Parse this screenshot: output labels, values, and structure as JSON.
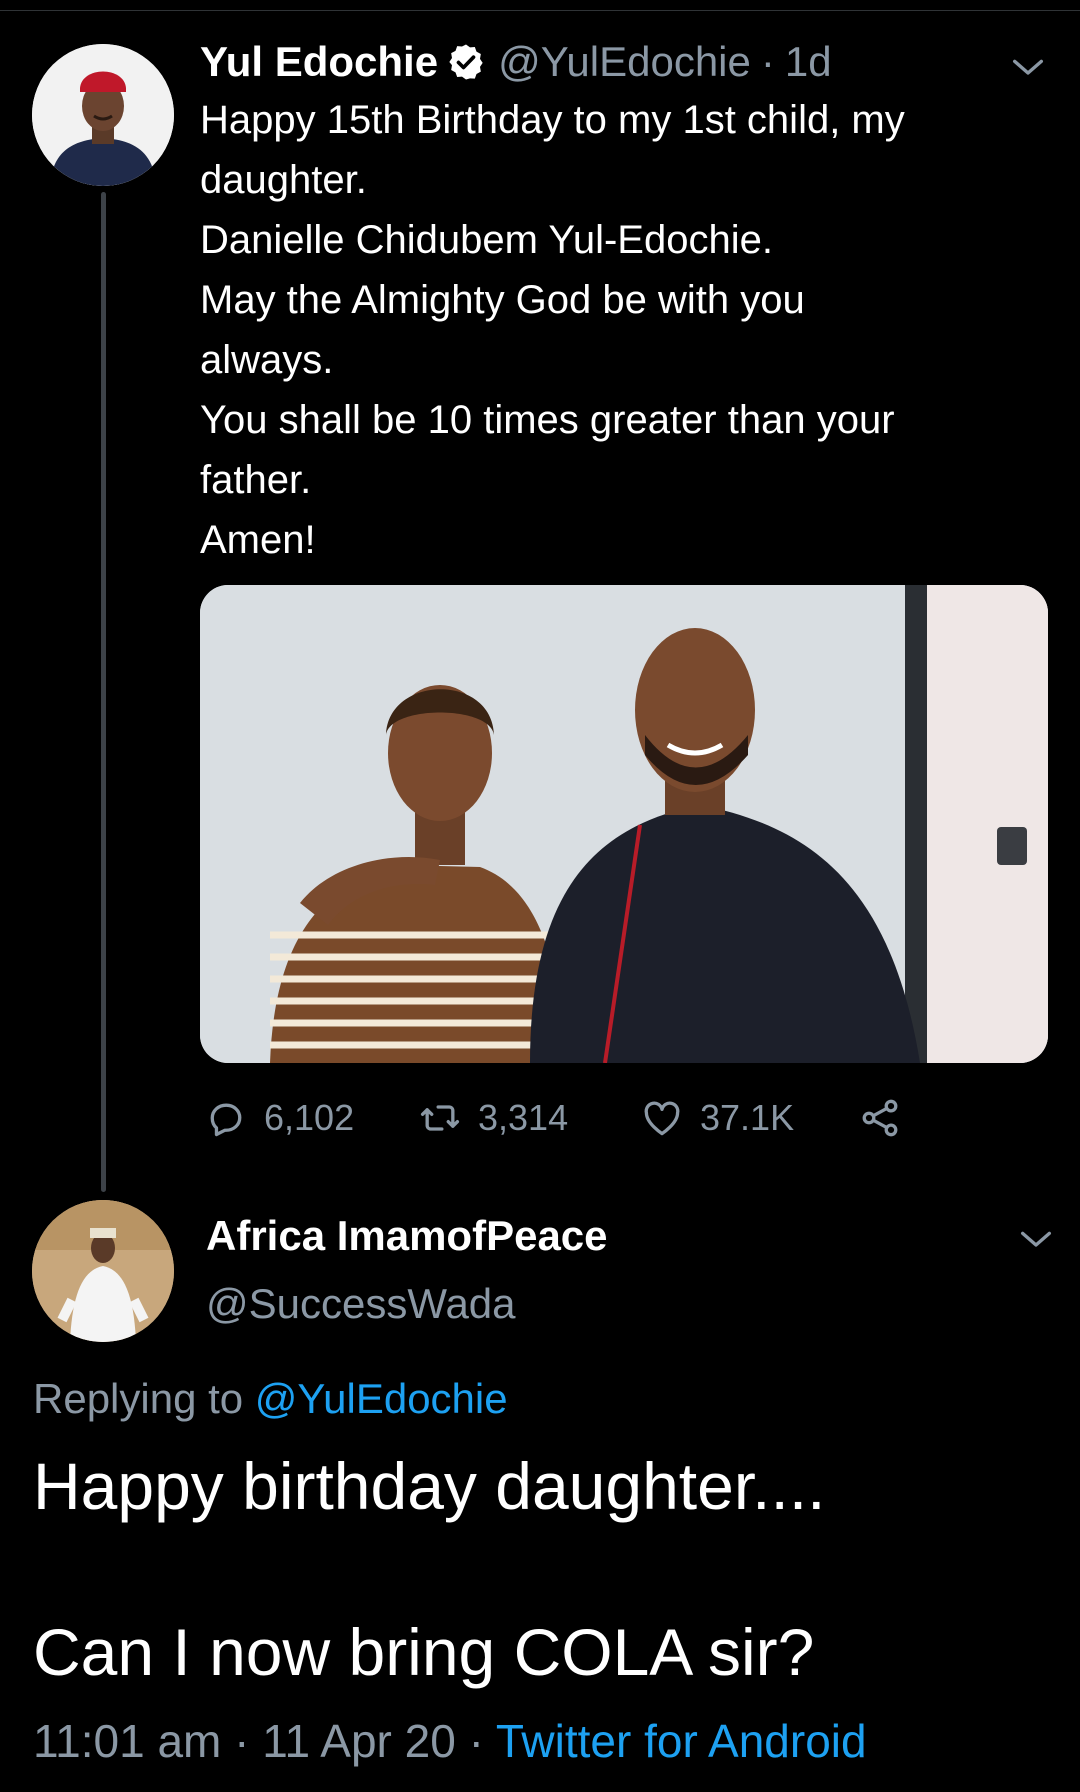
{
  "colors": {
    "background": "#000000",
    "text": "#ffffff",
    "muted": "#8b98a5",
    "link": "#1da1f2",
    "thread_line": "#3d4248"
  },
  "tweet": {
    "author_name": "Yul Edochie",
    "verified_icon": "verified-badge-icon",
    "handle": "@YulEdochie",
    "separator": "·",
    "time": "1d",
    "text_lines": [
      "Happy 15th Birthday to my 1st child, my",
      "daughter.",
      "Danielle Chidubem Yul-Edochie.",
      "May the Almighty God be with you",
      "always.",
      "You shall be 10 times greater than your",
      "father.",
      "Amen!"
    ],
    "actions": {
      "reply_count": "6,102",
      "retweet_count": "3,314",
      "like_count": "37.1K",
      "reply_icon": "reply-bubble-icon",
      "retweet_icon": "retweet-icon",
      "like_icon": "heart-icon",
      "share_icon": "share-icon"
    }
  },
  "reply": {
    "author_name": "Africa ImamofPeace",
    "handle": "@SuccessWada",
    "replying_prefix": "Replying to",
    "replying_to": "@YulEdochie",
    "text_line_1": "Happy birthday daughter....",
    "text_line_2": "Can I now bring COLA sir?",
    "timestamp": "11:01 am",
    "separator": "·",
    "date": "11 Apr 20",
    "source": "Twitter for Android"
  }
}
